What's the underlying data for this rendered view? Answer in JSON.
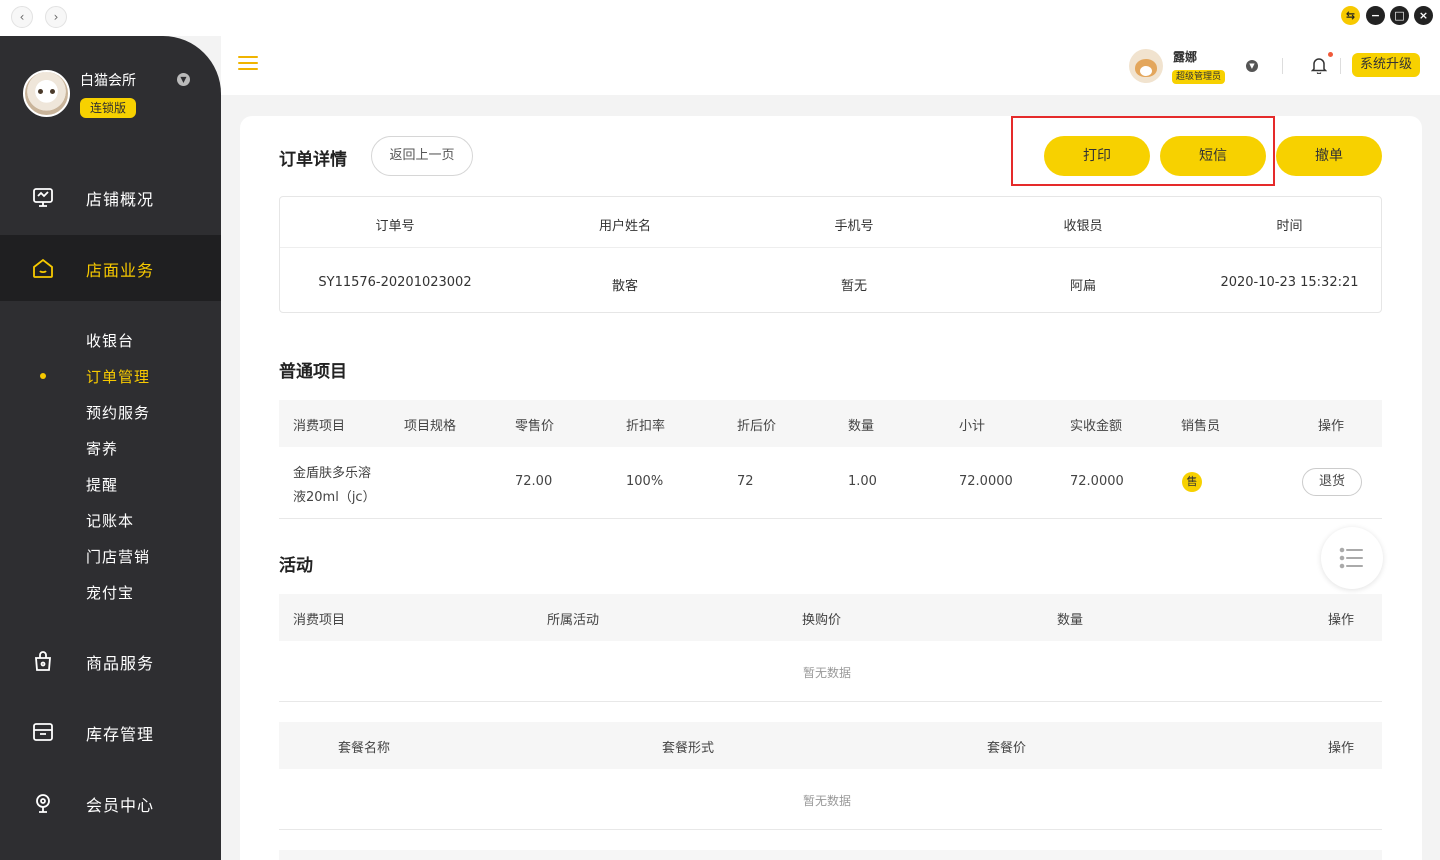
{
  "sidebar": {
    "brand": {
      "name": "白猫会所",
      "badge": "连锁版"
    },
    "nav": [
      {
        "label": "店铺概况",
        "icon": "monitor-icon"
      },
      {
        "label": "店面业务",
        "icon": "home-icon"
      },
      {
        "label": "商品服务",
        "icon": "bag-icon"
      },
      {
        "label": "库存管理",
        "icon": "archive-icon"
      },
      {
        "label": "会员中心",
        "icon": "member-icon"
      }
    ],
    "sub": [
      "收银台",
      "订单管理",
      "预约服务",
      "寄养",
      "提醒",
      "记账本",
      "门店营销",
      "宠付宝"
    ],
    "active_sub": "订单管理"
  },
  "header": {
    "user": {
      "name": "露娜",
      "role": "超级管理员"
    },
    "upgrade": "系统升级"
  },
  "page": {
    "title": "订单详情",
    "back": "返回上一页",
    "actions": {
      "print": "打印",
      "sms": "短信",
      "cancel": "撤单"
    }
  },
  "order_info": {
    "headers": [
      "订单号",
      "用户姓名",
      "手机号",
      "收银员",
      "时间"
    ],
    "values": [
      "SY11576-20201023002",
      "散客",
      "暂无",
      "阿扁",
      "2020-10-23 15:32:21"
    ]
  },
  "normal_items": {
    "title": "普通项目",
    "headers": [
      "消费项目",
      "项目规格",
      "零售价",
      "折扣率",
      "折后价",
      "数量",
      "小计",
      "实收金额",
      "销售员",
      "操作"
    ],
    "row": {
      "name_line1": "金盾肤多乐溶",
      "name_line2": "液20ml（jc）",
      "retail": "72.00",
      "discount": "100%",
      "after": "72",
      "qty": "1.00",
      "subtotal": "72.0000",
      "received": "72.0000",
      "seller_badge": "售",
      "action": "退货"
    }
  },
  "activity": {
    "title": "活动",
    "headers": [
      "消费项目",
      "所属活动",
      "换购价",
      "数量",
      "操作"
    ],
    "empty": "暂无数据"
  },
  "package": {
    "headers": [
      "套餐名称",
      "套餐形式",
      "套餐价",
      "操作"
    ],
    "empty": "暂无数据"
  }
}
